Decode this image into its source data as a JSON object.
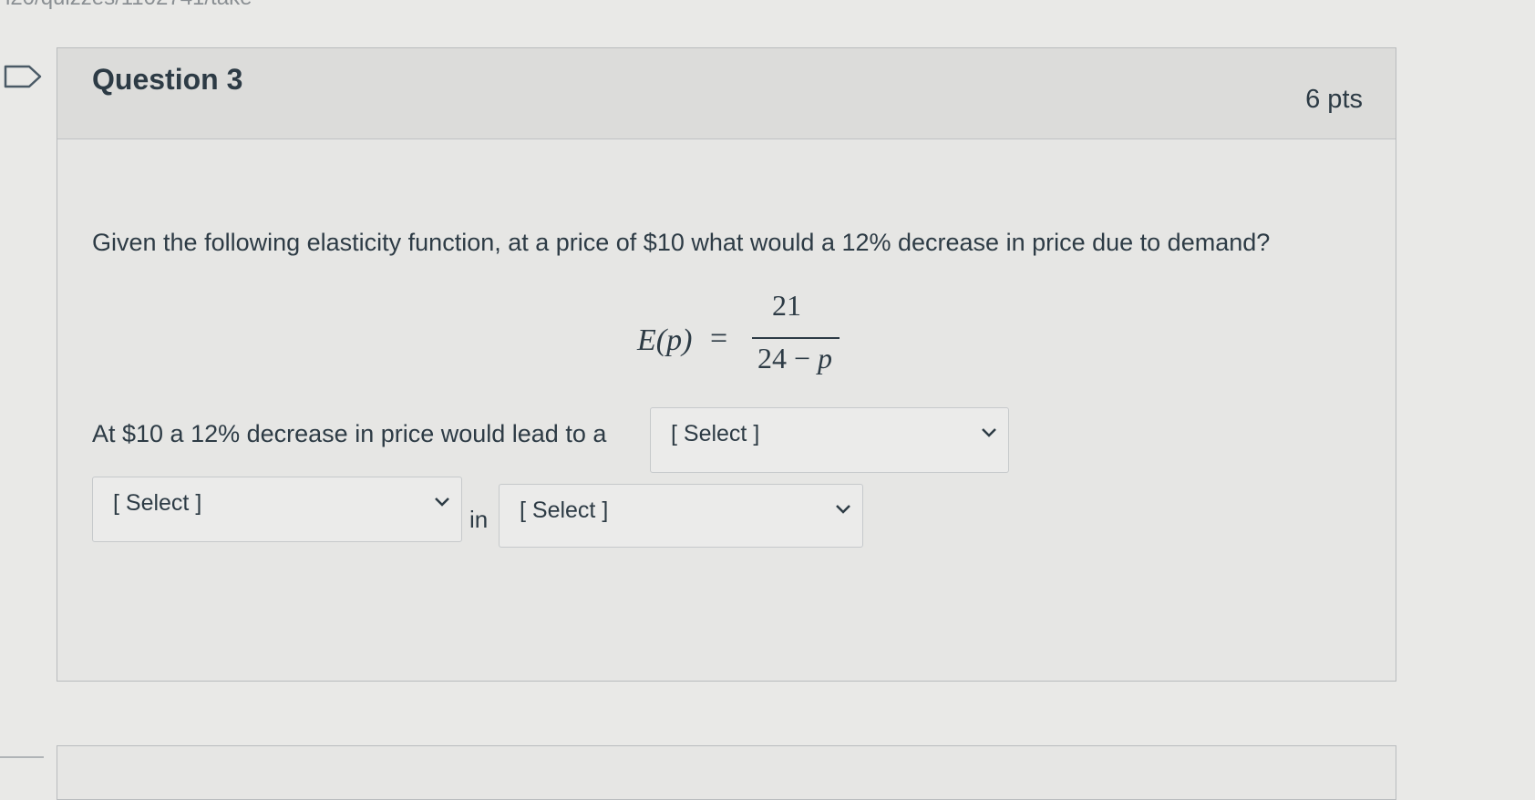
{
  "browser": {
    "url_fragment": "i20/quizzes/1102741/take"
  },
  "question": {
    "title": "Question 3",
    "points": "6 pts",
    "prompt": "Given the following elasticity function, at a price of $10 what would a 12% decrease in price due to demand?",
    "formula": {
      "lhs": "E(p)",
      "equals": "=",
      "numerator": "21",
      "denominator_prefix": "24 − ",
      "denominator_var": "p"
    },
    "answer_text": "At $10 a 12% decrease in price would lead to a",
    "in_label": "in",
    "dropdowns": [
      {
        "value": "[ Select ]"
      },
      {
        "value": "[ Select ]"
      },
      {
        "value": "[ Select ]"
      }
    ]
  },
  "icons": {
    "flag": "flag-icon",
    "chevron": "chevron-down-icon"
  },
  "colors": {
    "text": "#2d3b45",
    "card_background": "#e6e6e4",
    "header_background": "#dcdcda",
    "border": "#b9bcbe"
  }
}
